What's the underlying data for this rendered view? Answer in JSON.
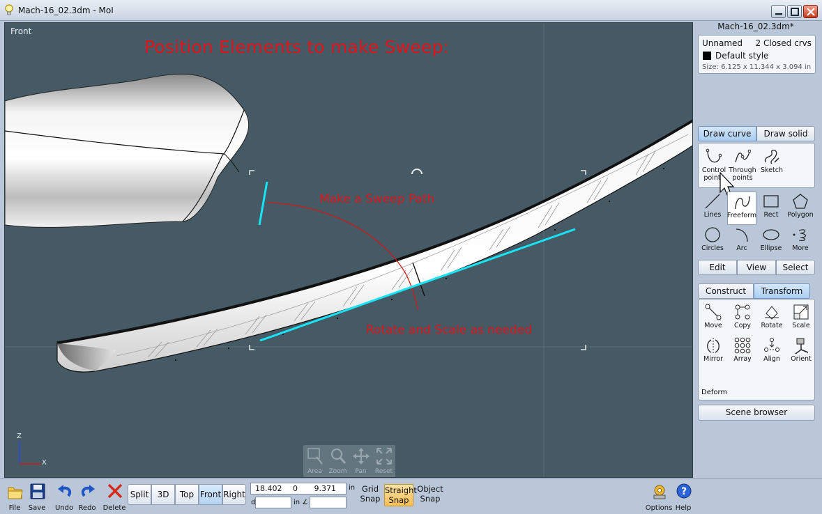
{
  "window": {
    "title": "Mach-16_02.3dm - MoI",
    "colors": {
      "viewport_bg": "#455a64",
      "accent_blue": "#a9cdf0",
      "annotation_red": "#e0141b",
      "path_cyan": "#19e3f5"
    }
  },
  "viewport": {
    "label": "Front",
    "annotations": {
      "title": "Position Elements to make Sweep:",
      "sweep_path": "Make a Sweep Path",
      "rotate_scale": "Rotate and Scale as needed"
    },
    "axes": {
      "z": "Z",
      "x": "X"
    },
    "nav": [
      {
        "label": "Area",
        "icon": "area-icon"
      },
      {
        "label": "Zoom",
        "icon": "magnifier-icon"
      },
      {
        "label": "Pan",
        "icon": "pan-arrows-icon"
      },
      {
        "label": "Reset",
        "icon": "reset-icon"
      }
    ]
  },
  "panel": {
    "file_title": "Mach-16_02.3dm*",
    "properties": {
      "name": "Unnamed",
      "selection": "2 Closed crvs",
      "style": "Default style",
      "size": "Size: 6.125 x 11.344 x 3.094 in"
    },
    "draw_tabs": {
      "curve": "Draw curve",
      "solid": "Draw solid"
    },
    "draw_tools": [
      {
        "label": "Control points",
        "icon": "control-points-curve-icon"
      },
      {
        "label": "Through points",
        "icon": "through-points-curve-icon"
      },
      {
        "label": "Sketch",
        "icon": "sketch-curve-icon"
      }
    ],
    "shape_tools": [
      {
        "label": "Lines",
        "icon": "line-icon"
      },
      {
        "label": "Freeform",
        "icon": "freeform-icon"
      },
      {
        "label": "Rect",
        "icon": "rectangle-icon"
      },
      {
        "label": "Polygon",
        "icon": "polygon-icon"
      },
      {
        "label": "Circles",
        "icon": "circle-icon"
      },
      {
        "label": "Arc",
        "icon": "arc-icon"
      },
      {
        "label": "Ellipse",
        "icon": "ellipse-icon"
      },
      {
        "label": "More",
        "icon": "helix-icon"
      }
    ],
    "evs": {
      "edit": "Edit",
      "view": "View",
      "select": "Select"
    },
    "ct_tabs": {
      "construct": "Construct",
      "transform": "Transform"
    },
    "transform_tools": [
      {
        "label": "Move",
        "icon": "move-icon"
      },
      {
        "label": "Copy",
        "icon": "copy-icon"
      },
      {
        "label": "Rotate",
        "icon": "rotate-icon"
      },
      {
        "label": "Scale",
        "icon": "scale-icon"
      },
      {
        "label": "Mirror",
        "icon": "mirror-icon"
      },
      {
        "label": "Array",
        "icon": "array-icon"
      },
      {
        "label": "Align",
        "icon": "align-icon"
      },
      {
        "label": "Orient",
        "icon": "orient-icon"
      }
    ],
    "deform": "Deform",
    "scene_browser": "Scene browser"
  },
  "bottom": {
    "file": "File",
    "save": "Save",
    "undo": "Undo",
    "redo": "Redo",
    "delete": "Delete",
    "views": {
      "split": "Split",
      "three_d": "3D",
      "top": "Top",
      "front": "Front",
      "right": "Right"
    },
    "coords": {
      "x": "18.402",
      "y": "0",
      "z": "9.371",
      "unit": "in",
      "d_label": "d",
      "angle_label": "in ∠"
    },
    "snaps": {
      "grid": "Grid Snap",
      "straight": "Straight Snap",
      "object": "Object Snap"
    },
    "options": "Options",
    "help": "Help"
  }
}
